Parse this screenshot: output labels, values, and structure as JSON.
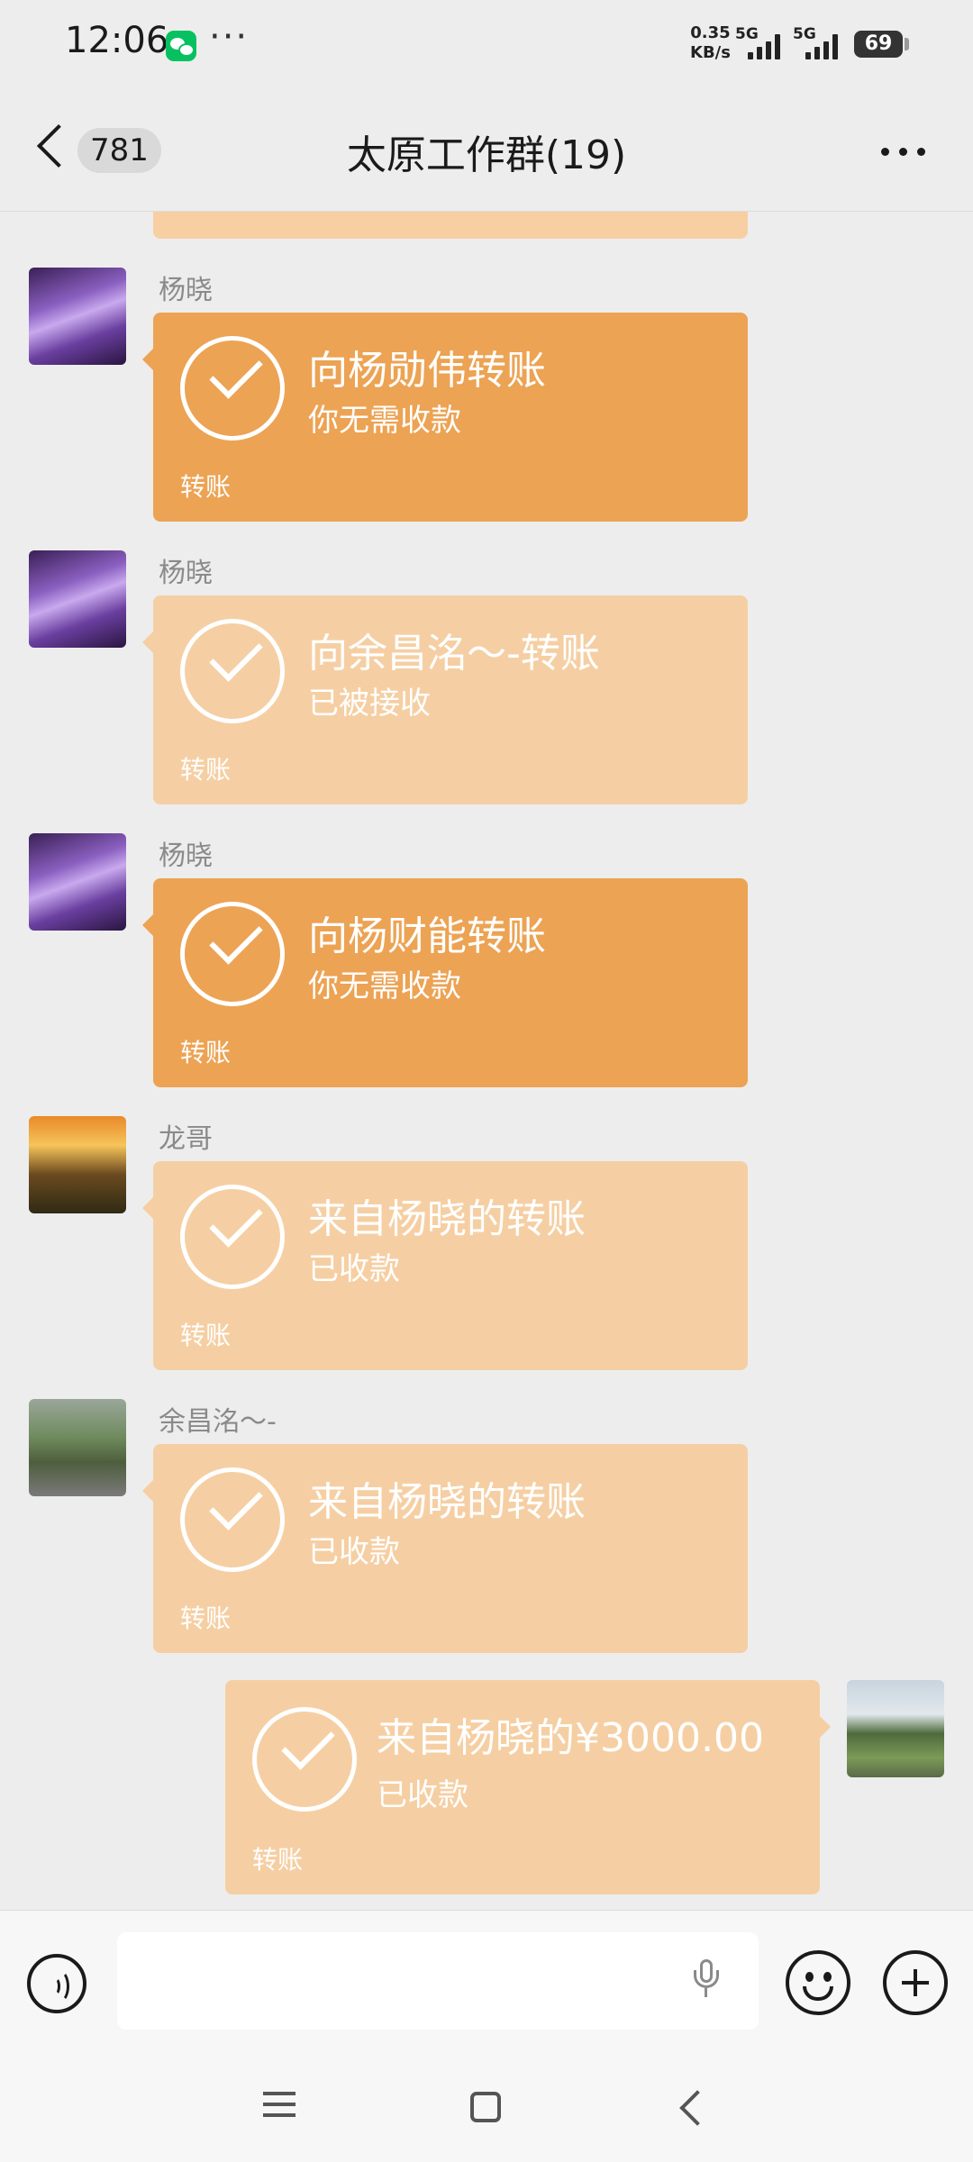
{
  "status_bar": {
    "time": "12:06",
    "dots": "···",
    "net_speed_value": "0.35",
    "net_speed_unit": "KB/s",
    "sig1_label": "5G",
    "sig2_label": "5G",
    "battery": "69"
  },
  "header": {
    "unread_count": "781",
    "title": "太原工作群(19)"
  },
  "messages": [
    {
      "sender": "杨晓",
      "title": "向杨勋伟转账",
      "subtitle": "你无需收款",
      "footer": "转账",
      "style": "dark"
    },
    {
      "sender": "杨晓",
      "title": "向余昌洺～-转账",
      "subtitle": "已被接收",
      "footer": "转账",
      "style": "light"
    },
    {
      "sender": "杨晓",
      "title": "向杨财能转账",
      "subtitle": "你无需收款",
      "footer": "转账",
      "style": "dark"
    },
    {
      "sender": "龙哥",
      "title": "来自杨晓的转账",
      "subtitle": "已收款",
      "footer": "转账",
      "style": "light"
    },
    {
      "sender": "余昌洺～-",
      "title": "来自杨晓的转账",
      "subtitle": "已收款",
      "footer": "转账",
      "style": "light"
    },
    {
      "sender": "",
      "title": "来自杨晓的¥3000.00",
      "subtitle": "已收款",
      "footer": "转账",
      "style": "light"
    }
  ],
  "icons": {
    "back": "chevron-left-icon",
    "more": "more-dots-icon",
    "voice": "voice-icon",
    "mic": "mic-icon",
    "emoji": "emoji-icon",
    "plus": "plus-icon",
    "transfer": "check-circle-icon"
  },
  "colors": {
    "transfer_active": "#eca354",
    "transfer_done": "#f5cfa3",
    "background": "#ededed"
  }
}
